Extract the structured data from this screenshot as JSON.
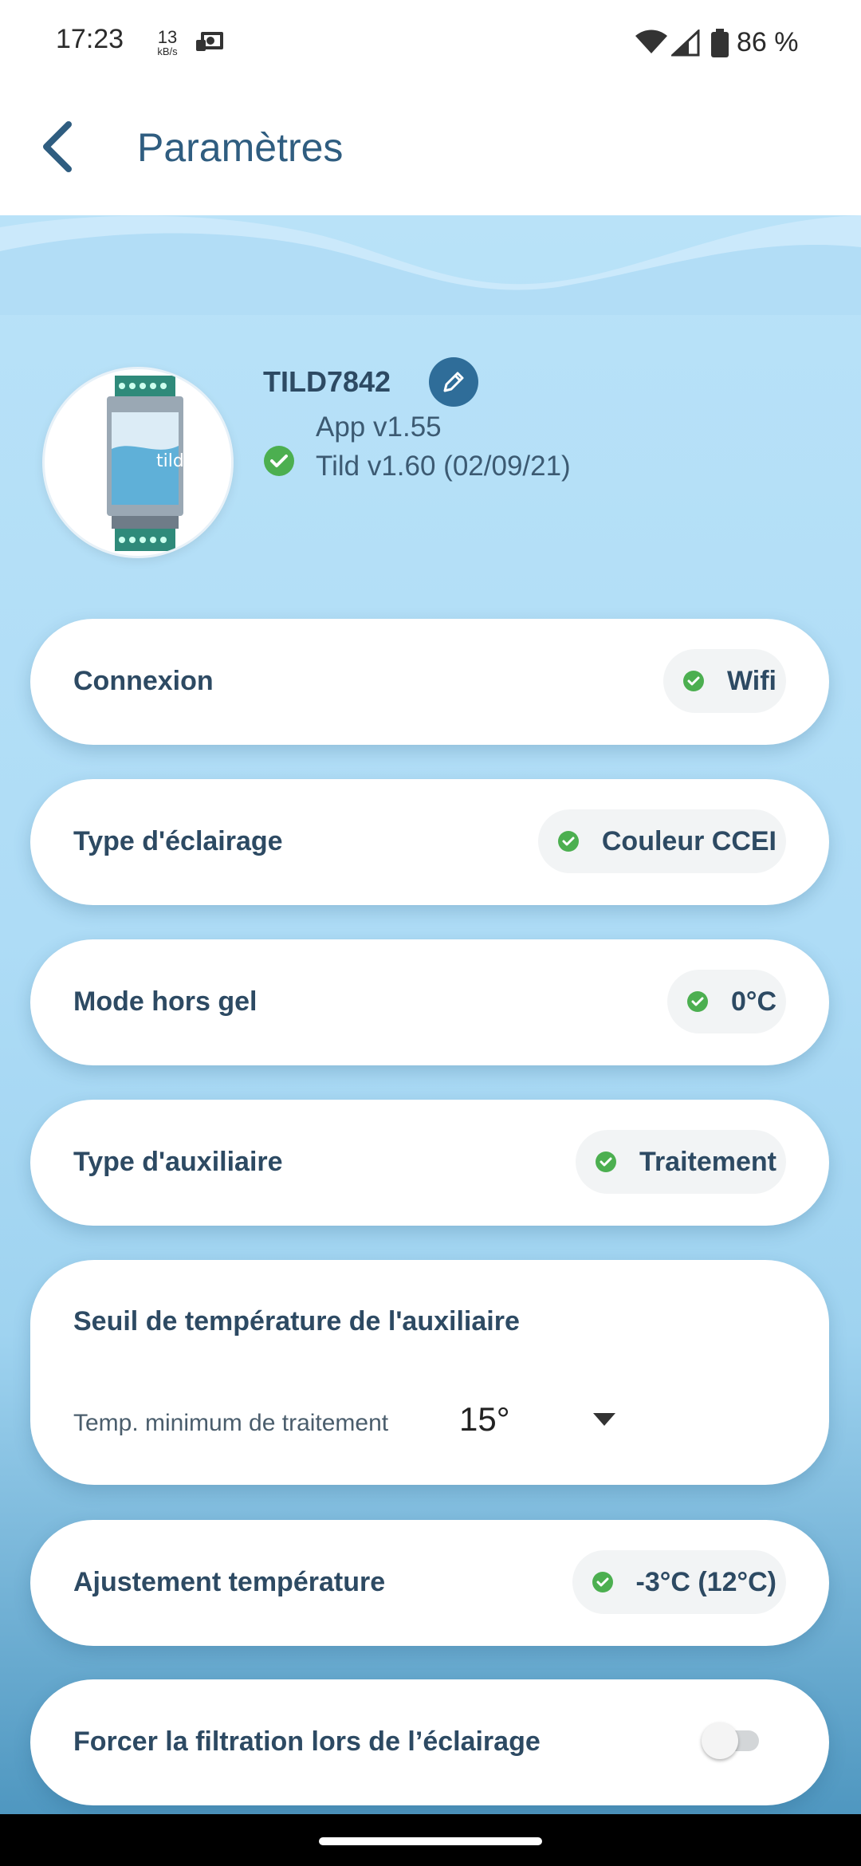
{
  "status_bar": {
    "time": "17:23",
    "speed_value": "13",
    "speed_unit": "kB/s",
    "battery_percent": "86 %",
    "icons": [
      "cast-icon",
      "wifi-icon",
      "signal-icon",
      "battery-icon"
    ]
  },
  "header": {
    "title": "Paramètres",
    "back_icon": "chevron-left-icon"
  },
  "device": {
    "name": "TILD7842",
    "app_version": "App v1.55",
    "tild_version": "Tild v1.60 (02/09/21)",
    "image_brand": "tild",
    "edit_icon": "pencil-icon",
    "status_icon": "check-circle-icon"
  },
  "settings": [
    {
      "label": "Connexion",
      "value": "Wifi"
    },
    {
      "label": "Type d'éclairage",
      "value": "Couleur CCEI"
    },
    {
      "label": "Mode hors gel",
      "value": "0°C"
    },
    {
      "label": "Type d'auxiliaire",
      "value": "Traitement"
    }
  ],
  "threshold": {
    "title": "Seuil de température de l'auxiliaire",
    "field_label": "Temp. minimum de traitement",
    "field_value": "15°",
    "dropdown_icon": "caret-down-icon"
  },
  "adjustment": {
    "label": "Ajustement température",
    "value": "-3°C (12°C)"
  },
  "force_filtration": {
    "label": "Forcer la filtration lors de l’éclairage",
    "enabled": false
  },
  "colors": {
    "accent": "#2f6d99",
    "success": "#4caf50",
    "text": "#2d4a63",
    "background": "#aedcf6"
  }
}
